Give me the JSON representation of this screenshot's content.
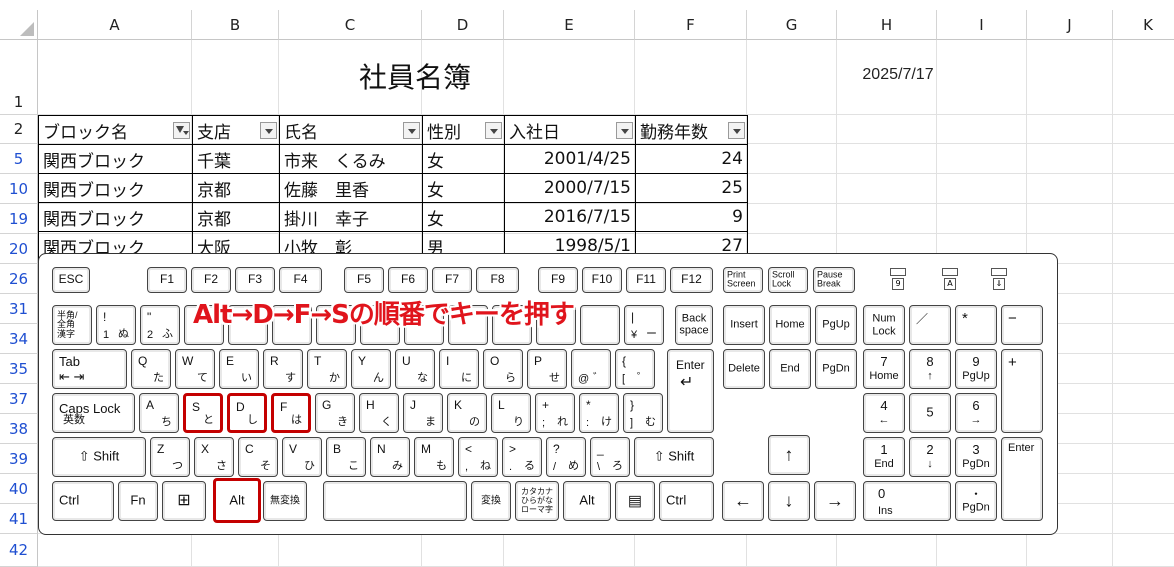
{
  "columns": [
    "A",
    "B",
    "C",
    "D",
    "E",
    "F",
    "G",
    "H",
    "I",
    "J",
    "K"
  ],
  "rows": [
    "1",
    "2",
    "5",
    "10",
    "19",
    "20",
    "26",
    "31",
    "34",
    "35",
    "37",
    "38",
    "39",
    "40",
    "41",
    "42"
  ],
  "sheet_title": "社員名簿",
  "date": "2025/7/17",
  "table": {
    "headers": [
      "ブロック名",
      "支店",
      "氏名",
      "性別",
      "入社日",
      "勤務年数"
    ],
    "rows": [
      [
        "関西ブロック",
        "千葉",
        "市来　くるみ",
        "女",
        "2001/4/25",
        "24"
      ],
      [
        "関西ブロック",
        "京都",
        "佐藤　里香",
        "女",
        "2000/7/15",
        "25"
      ],
      [
        "関西ブロック",
        "京都",
        "掛川　幸子",
        "女",
        "2016/7/15",
        "9"
      ],
      [
        "関西ブロック",
        "大阪",
        "小牧　彰",
        "男",
        "1998/5/1",
        "27"
      ]
    ]
  },
  "caption": "Alt→D→F→Sの順番でキーを押す",
  "keys": {
    "esc": "ESC",
    "f1": "F1",
    "f2": "F2",
    "f3": "F3",
    "f4": "F4",
    "f5": "F5",
    "f6": "F6",
    "f7": "F7",
    "f8": "F8",
    "f9": "F9",
    "f10": "F10",
    "f11": "F11",
    "f12": "F12",
    "prtsc1": "Print",
    "prtsc2": "Screen",
    "scrlk1": "Scroll",
    "scrlk2": "Lock",
    "pause1": "Pause",
    "pause2": "Break",
    "hankaku1": "半角/",
    "hankaku2": "全角",
    "hankaku3": "漢字",
    "k1_top": "!",
    "k1_num": "1",
    "k1_kana": "ぬ",
    "k2_top": "\"",
    "k2_num": "2",
    "k2_kana": "ふ",
    "k0_top": "|",
    "k0_l": "¥",
    "k0_kana": "ー",
    "yen_kana": "ー",
    "back1": "Back",
    "back2": "space",
    "tab": "Tab",
    "q": "Q",
    "q_k": "た",
    "w": "W",
    "w_k": "て",
    "e": "E",
    "e_k": "い",
    "r": "R",
    "r_k": "す",
    "t": "T",
    "t_k": "か",
    "y": "Y",
    "y_k": "ん",
    "u": "U",
    "u_k": "な",
    "i": "I",
    "i_k": "に",
    "o": "O",
    "o_k": "ら",
    "p": "P",
    "p_k": "せ",
    "at": "@",
    "at_k": "゛",
    "lb_top": "{",
    "lb": "[",
    "lb_k": "゜",
    "enter": "Enter",
    "caps1": "Caps Lock",
    "caps2": "英数",
    "a": "A",
    "a_k": "ち",
    "s": "S",
    "s_k": "と",
    "d": "D",
    "d_k": "し",
    "f": "F",
    "f_k": "は",
    "g": "G",
    "g_k": "き",
    "h": "H",
    "h_k": "く",
    "j": "J",
    "j_k": "ま",
    "k": "K",
    "k_k": "の",
    "l": "L",
    "l_k": "り",
    "semi_top": "+",
    "semi": ";",
    "semi_k": "れ",
    "colon_top": "*",
    "colon": ":",
    "colon_k": "け",
    "rb_top": "}",
    "rb": "]",
    "rb_k": "む",
    "lshift": "Shift",
    "z": "Z",
    "z_k": "つ",
    "x": "X",
    "x_k": "さ",
    "c": "C",
    "c_k": "そ",
    "v": "V",
    "v_k": "ひ",
    "b": "B",
    "b_k": "こ",
    "n": "N",
    "n_k": "み",
    "m": "M",
    "m_k": "も",
    "comma_top": "<",
    "comma": ",",
    "comma_k": "ね",
    "dot_top": ">",
    "dot": ".",
    "dot_k": "る",
    "slash_top": "?",
    "slash": "/",
    "slash_k": "め",
    "bs_top": "_",
    "bs": "\\",
    "bs_k": "ろ",
    "rshift": "Shift",
    "lctrl": "Ctrl",
    "fn": "Fn",
    "alt": "Alt",
    "muhenkan": "無変換",
    "henkan": "変換",
    "kana1": "カタカナ",
    "kana2": "ひらがな",
    "kana3": "ローマ字",
    "ralt": "Alt",
    "rctrl": "Ctrl",
    "insert": "Insert",
    "home": "Home",
    "pgup": "PgUp",
    "delete": "Delete",
    "end": "End",
    "pgdn": "PgDn",
    "up": "↑",
    "left": "←",
    "down": "↓",
    "right": "→",
    "numlk1": "Num",
    "numlk2": "Lock",
    "np_div": "／",
    "np_mul": "*",
    "np_sub": "−",
    "np_add": "+",
    "np7": "7",
    "np7b": "Home",
    "np8": "8",
    "np8b": "↑",
    "np9": "9",
    "np9b": "PgUp",
    "np4": "4",
    "np4b": "←",
    "np5": "5",
    "np6": "6",
    "np6b": "→",
    "np1": "1",
    "np1b": "End",
    "np2": "2",
    "np2b": "↓",
    "np3": "3",
    "np3b": "PgDn",
    "np_enter": "Enter",
    "np0": "0",
    "np0b": "Ins",
    "npdot": "・",
    "npdotb": "PgDn",
    "led1": "9",
    "led2": "A",
    "led3": "⇓"
  }
}
